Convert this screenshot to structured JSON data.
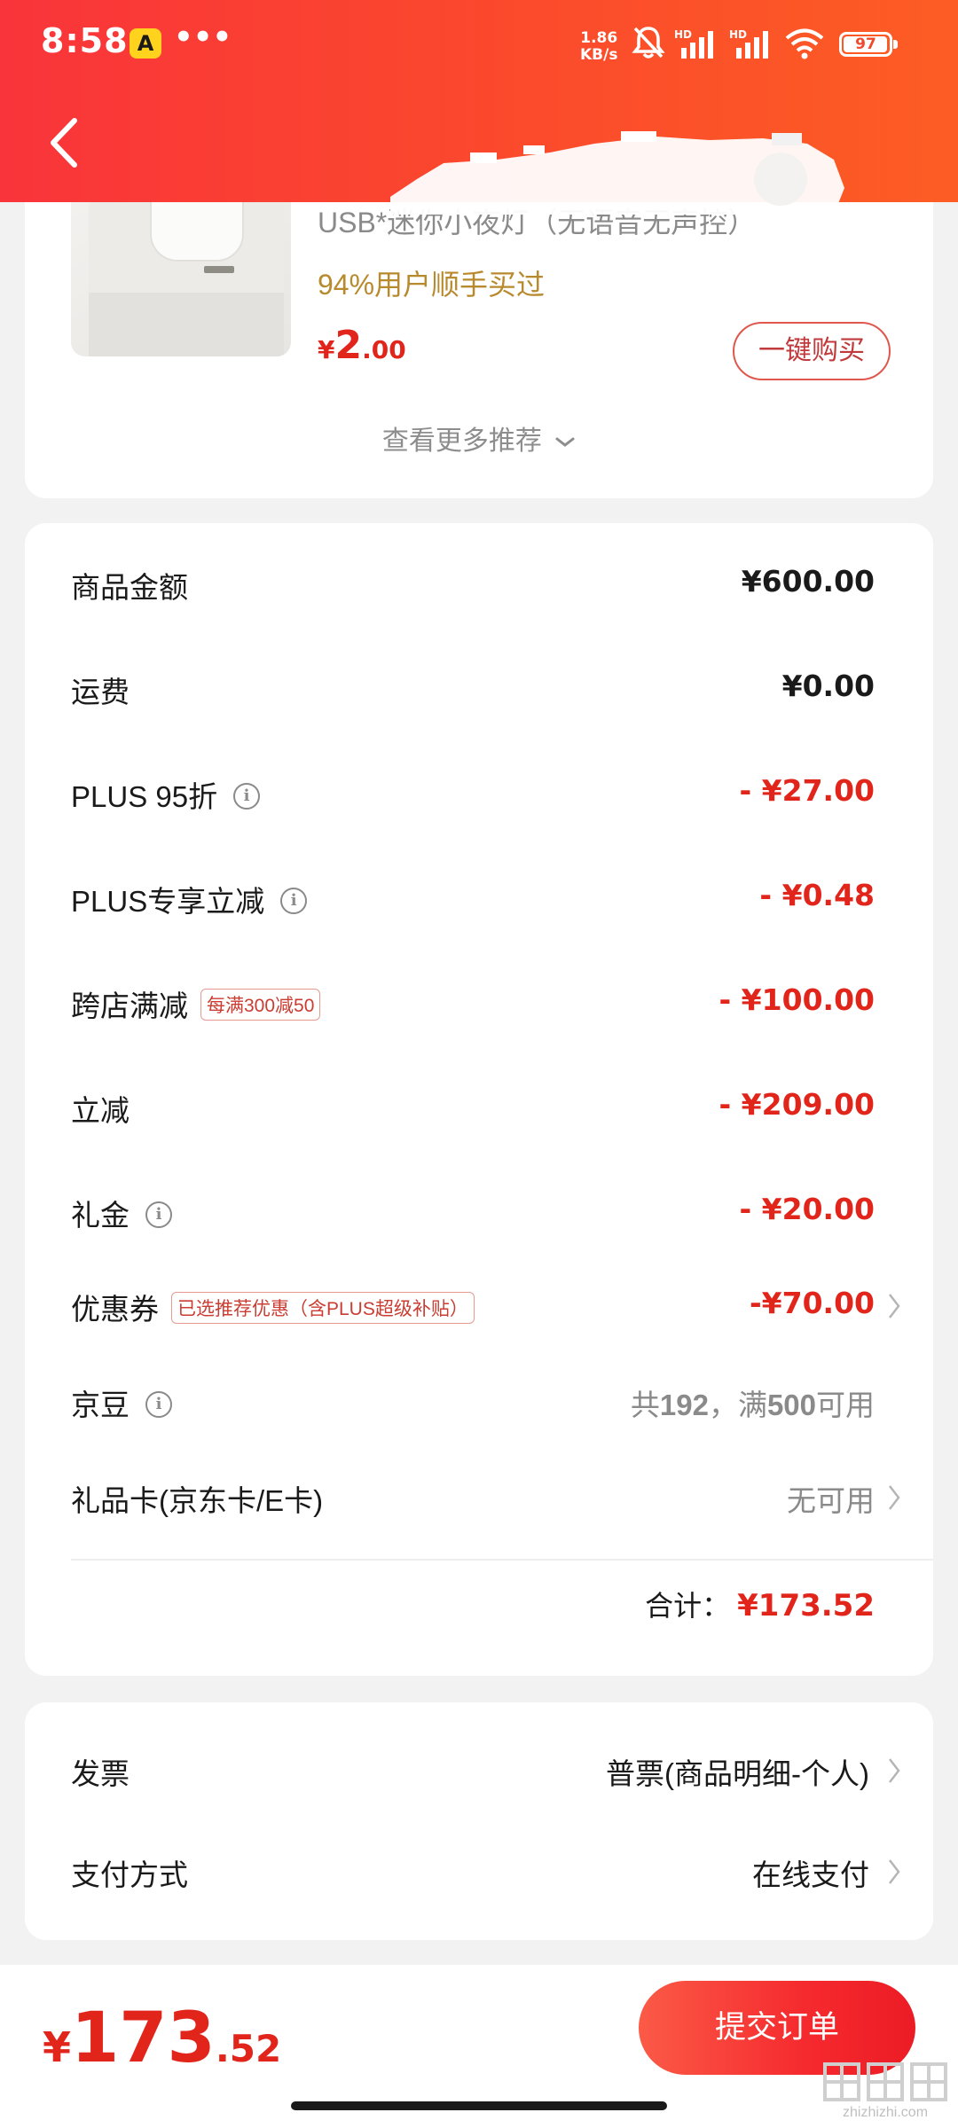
{
  "status_bar": {
    "time": "8:58",
    "app_badge": "A",
    "more": "•••",
    "net_speed_value": "1.86",
    "net_speed_unit": "KB/s",
    "battery_level": "97",
    "battery_fraction": 0.97
  },
  "header": {
    "back_icon": "chevron-left-icon"
  },
  "recommendation": {
    "name": "USB*迷你小夜灯（无语音无声控）",
    "tag": "94%用户顺手买过",
    "price_currency": "¥",
    "price_int": "2",
    "price_dec": ".00",
    "quick_buy": "一键购买",
    "more_link": "查看更多推荐"
  },
  "price_rows": [
    {
      "label": "商品金额",
      "value": "¥600.00"
    },
    {
      "label": "运费",
      "value": "¥0.00"
    },
    {
      "label": "PLUS 95折",
      "value": "- ¥27.00"
    },
    {
      "label": "PLUS专享立减",
      "value": "- ¥0.48"
    },
    {
      "label": "跨店满减",
      "tag": "每满300减50",
      "value": "- ¥100.00"
    },
    {
      "label": "立减",
      "value": "- ¥209.00"
    },
    {
      "label": "礼金",
      "value": "- ¥20.00"
    },
    {
      "label": "优惠券",
      "tag": "已选推荐优惠（含PLUS超级补贴）",
      "value": "-¥70.00"
    },
    {
      "label": "京豆",
      "value_prefix": "共",
      "value_count": "192",
      "value_mid": "，满",
      "value_threshold": "500",
      "value_suffix": "可用"
    },
    {
      "label": "礼品卡(京东卡/E卡)",
      "value": "无可用"
    }
  ],
  "total": {
    "label": "合计：",
    "value": "¥173.52"
  },
  "invoice": {
    "label": "发票",
    "value": "普票(商品明细-个人)"
  },
  "payment": {
    "label": "支付方式",
    "value": "在线支付"
  },
  "bottom_bar": {
    "currency": "¥",
    "price_int": "173",
    "price_dec": ".52",
    "submit": "提交订单"
  },
  "watermark": {
    "text": "zhizhizhi.com"
  },
  "colors": {
    "accent_red": "#e1251b",
    "header_gradient_start": "#f9343a",
    "header_gradient_end": "#fd5d24",
    "tag_gold": "#b88a2e"
  }
}
